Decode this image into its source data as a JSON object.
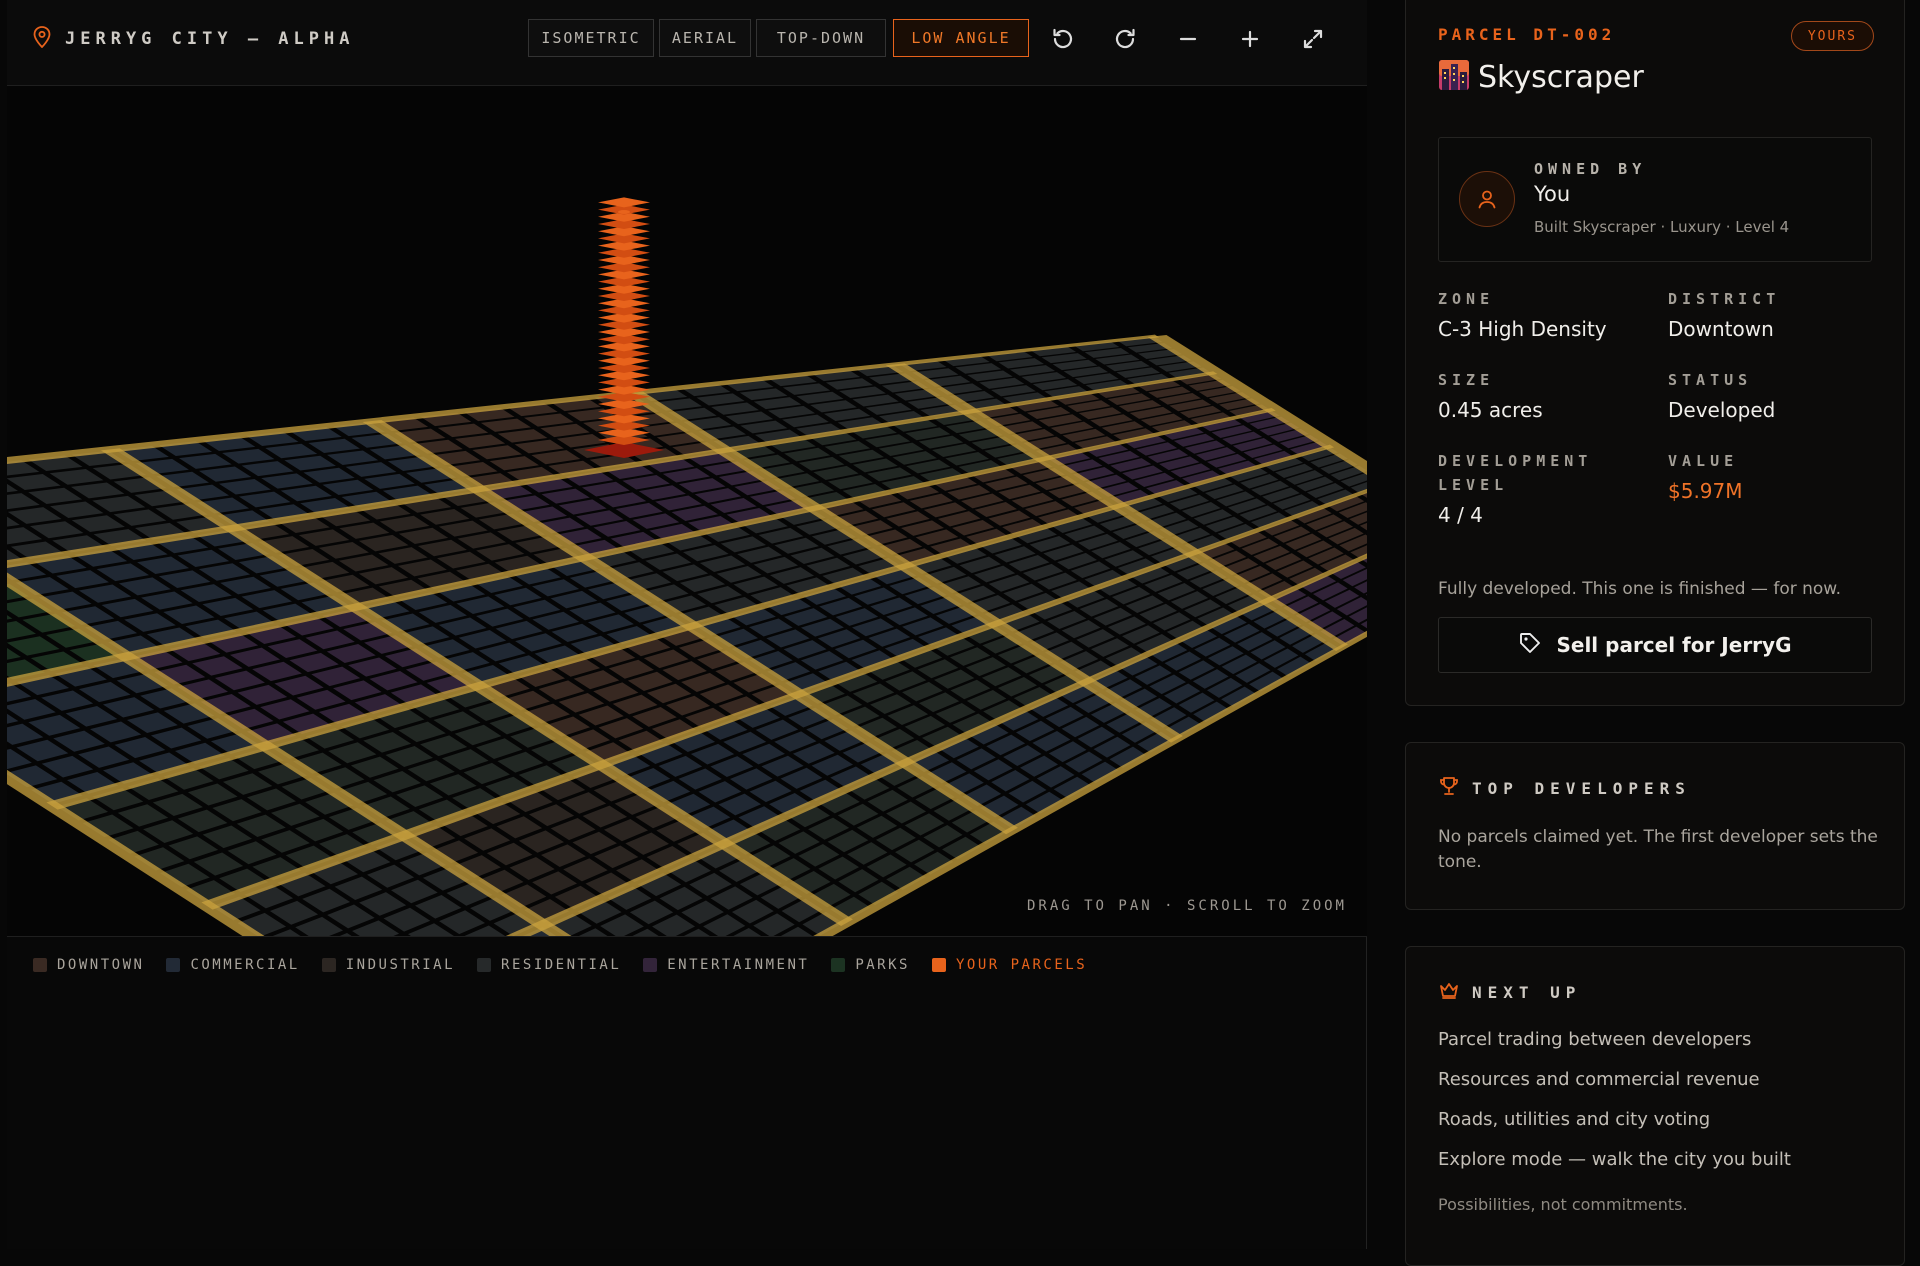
{
  "header": {
    "city_title": "JERRYG CITY — ALPHA",
    "view_modes": [
      "ISOMETRIC",
      "AERIAL",
      "TOP-DOWN",
      "LOW ANGLE"
    ],
    "active_view": "LOW ANGLE",
    "tools": [
      "rotate-left-icon",
      "rotate-right-icon",
      "zoom-out-icon",
      "zoom-in-icon",
      "fullscreen-icon"
    ]
  },
  "map": {
    "hint": "DRAG TO PAN · SCROLL TO ZOOM",
    "legend": [
      {
        "label": "DOWNTOWN",
        "color": "#3a2a23"
      },
      {
        "label": "COMMERCIAL",
        "color": "#222a36"
      },
      {
        "label": "INDUSTRIAL",
        "color": "#2c2622"
      },
      {
        "label": "RESIDENTIAL",
        "color": "#26292a"
      },
      {
        "label": "ENTERTAINMENT",
        "color": "#33243a"
      },
      {
        "label": "PARKS",
        "color": "#1c3322"
      },
      {
        "label": "YOUR PARCELS",
        "color": "#e8631c"
      }
    ]
  },
  "parcel": {
    "code": "PARCEL DT-002",
    "badge": "YOURS",
    "name": "Skyscraper",
    "owned_by_label": "OWNED BY",
    "owner": "You",
    "owner_meta": "Built Skyscraper · Luxury · Level 4",
    "fields": {
      "zone_label": "ZONE",
      "zone": "C-3 High Density",
      "district_label": "DISTRICT",
      "district": "Downtown",
      "size_label": "SIZE",
      "size": "0.45 acres",
      "status_label": "STATUS",
      "status": "Developed",
      "dev_label_1": "DEVELOPMENT",
      "dev_label_2": "LEVEL",
      "dev": "4 / 4",
      "value_label": "VALUE",
      "value": "$5.97M"
    },
    "note": "Fully developed. This one is finished — for now.",
    "sell_label": "Sell parcel for JerryG"
  },
  "top_developers": {
    "title": "TOP DEVELOPERS",
    "body": "No parcels claimed yet. The first developer sets the tone."
  },
  "next_up": {
    "title": "NEXT UP",
    "items": [
      "Parcel trading between developers",
      "Resources and commercial revenue",
      "Roads, utilities and city voting",
      "Explore mode — walk the city you built"
    ],
    "footer": "Possibilities, not commitments."
  },
  "colors": {
    "accent": "#e8631c",
    "road": "#c9a23e"
  }
}
